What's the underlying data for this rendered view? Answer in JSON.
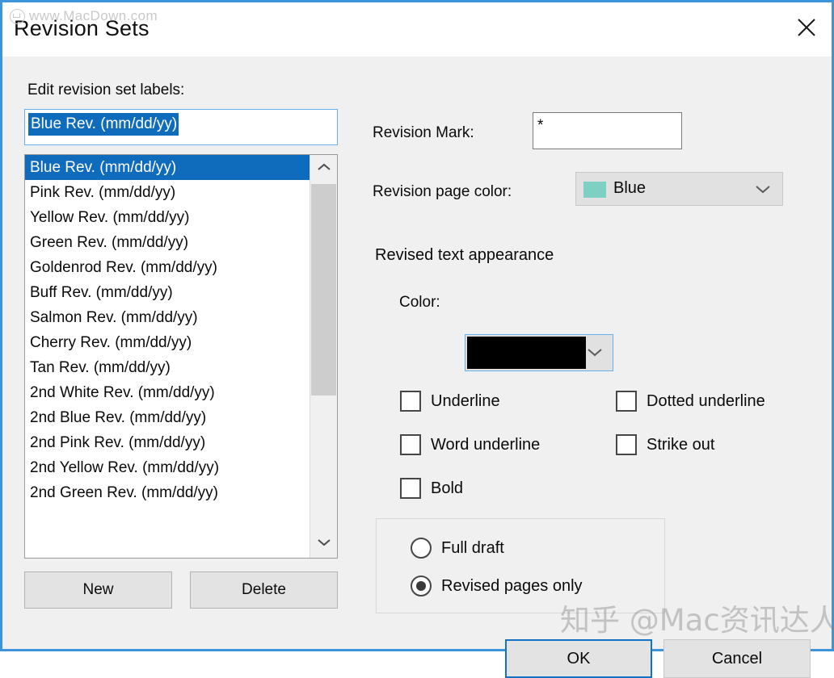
{
  "window": {
    "title": "Revision Sets",
    "close_icon": "close-icon"
  },
  "left_panel": {
    "caption": "Edit revision set labels:",
    "label_input": {
      "value": "Blue Rev. (mm/dd/yy)",
      "placeholder": ""
    },
    "list": {
      "selected_index": 0,
      "items": [
        "Blue Rev. (mm/dd/yy)",
        "Pink Rev. (mm/dd/yy)",
        "Yellow Rev. (mm/dd/yy)",
        "Green Rev. (mm/dd/yy)",
        "Goldenrod Rev. (mm/dd/yy)",
        "Buff Rev. (mm/dd/yy)",
        "Salmon Rev. (mm/dd/yy)",
        "Cherry Rev. (mm/dd/yy)",
        "Tan Rev. (mm/dd/yy)",
        "2nd White Rev. (mm/dd/yy)",
        "2nd Blue Rev. (mm/dd/yy)",
        "2nd Pink Rev. (mm/dd/yy)",
        "2nd Yellow Rev. (mm/dd/yy)",
        "2nd Green Rev. (mm/dd/yy)"
      ]
    },
    "new_label": "New",
    "delete_label": "Delete"
  },
  "right_panel": {
    "revision_mark": {
      "label": "Revision Mark:",
      "value": "*"
    },
    "page_color": {
      "label": "Revision page color:",
      "value": "Blue",
      "swatch_hex": "#7fd0c4",
      "chevron_icon": "chevron-down-icon"
    },
    "appearance": {
      "title": "Revised text appearance",
      "color_label": "Color:",
      "color_swatch_hex": "#000000",
      "color_chevron_icon": "chevron-down-icon",
      "checkboxes": [
        {
          "label": "Underline",
          "checked": false
        },
        {
          "label": "Dotted underline",
          "checked": false
        },
        {
          "label": "Word underline",
          "checked": false
        },
        {
          "label": "Strike out",
          "checked": false
        },
        {
          "label": "Bold",
          "checked": false
        }
      ]
    },
    "draft_mode": {
      "options": [
        {
          "label": "Full draft",
          "selected": false
        },
        {
          "label": "Revised pages only",
          "selected": true
        }
      ]
    }
  },
  "footer": {
    "ok_label": "OK",
    "cancel_label": "Cancel"
  },
  "watermarks": {
    "top": "www.MacDown.com",
    "bottom": "知乎 @Mac资讯达人"
  },
  "colors": {
    "accent": "#0f6cbd",
    "dialog_border": "#3d94d9",
    "body_bg": "#f0f0f0",
    "button_bg": "#e3e3e3"
  }
}
